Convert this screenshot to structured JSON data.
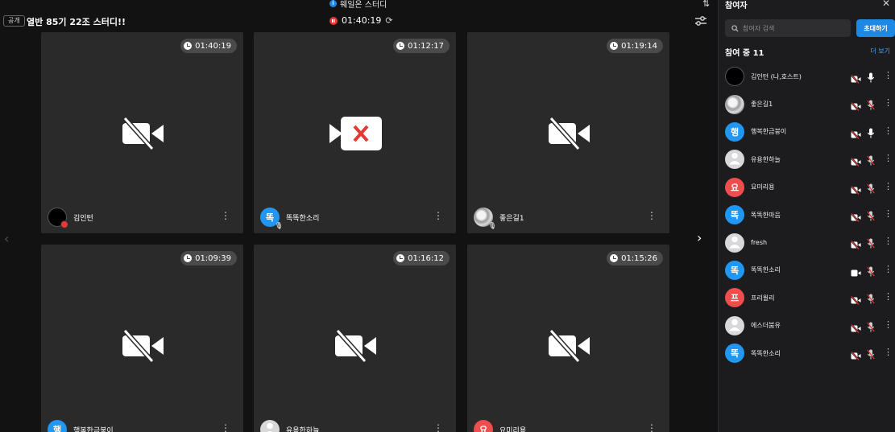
{
  "topbar": {
    "service_title": "웨일온 스터디"
  },
  "header": {
    "visibility_badge": "공개",
    "room_title": "열반 85기 22조 스터디!!",
    "recording_time": "01:40:19"
  },
  "tiles": [
    {
      "name": "김인턴",
      "timer": "01:40:19",
      "video": "camera-off",
      "avatar": {
        "type": "dark",
        "letter": ""
      },
      "badge": "host"
    },
    {
      "name": "똑똑한소리",
      "timer": "01:12:17",
      "video": "camera-error",
      "avatar": {
        "type": "blue",
        "letter": "똑"
      },
      "badge": "mic-off"
    },
    {
      "name": "좋은길1",
      "timer": "01:19:14",
      "video": "camera-off",
      "avatar": {
        "type": "photo",
        "letter": ""
      },
      "badge": "mic-off"
    },
    {
      "name": "행복한금붕이",
      "timer": "01:09:39",
      "video": "camera-off",
      "avatar": {
        "type": "blue",
        "letter": "행"
      },
      "badge": ""
    },
    {
      "name": "유용한하늘",
      "timer": "01:16:12",
      "video": "camera-off",
      "avatar": {
        "type": "gray",
        "letter": ""
      },
      "badge": ""
    },
    {
      "name": "요미리용",
      "timer": "01:15:26",
      "video": "camera-off",
      "avatar": {
        "type": "red",
        "letter": "요"
      },
      "badge": ""
    }
  ],
  "sidebar": {
    "title": "참여자",
    "search_placeholder": "참여자 검색",
    "invite_label": "초대하기",
    "count_label": "참여 중 11",
    "see_more_label": "더 보기",
    "participants": [
      {
        "name": "김인턴 (나,호스트)",
        "avatar": {
          "type": "dark",
          "letter": ""
        },
        "camera": "off",
        "mic": "on"
      },
      {
        "name": "좋은길1",
        "avatar": {
          "type": "photo",
          "letter": ""
        },
        "camera": "off",
        "mic": "off"
      },
      {
        "name": "행복한금붕이",
        "avatar": {
          "type": "blue",
          "letter": "행"
        },
        "camera": "off",
        "mic": "on"
      },
      {
        "name": "유용한하늘",
        "avatar": {
          "type": "gray",
          "letter": ""
        },
        "camera": "off",
        "mic": "off"
      },
      {
        "name": "요미리용",
        "avatar": {
          "type": "red",
          "letter": "요"
        },
        "camera": "off",
        "mic": "off"
      },
      {
        "name": "똑똑한마음",
        "avatar": {
          "type": "blue",
          "letter": "똑"
        },
        "camera": "off",
        "mic": "off"
      },
      {
        "name": "fresh",
        "avatar": {
          "type": "gray",
          "letter": ""
        },
        "camera": "off",
        "mic": "off"
      },
      {
        "name": "똑똑한소리",
        "avatar": {
          "type": "blue",
          "letter": "똑"
        },
        "camera": "on",
        "mic": "off"
      },
      {
        "name": "프리윌리",
        "avatar": {
          "type": "red",
          "letter": "프"
        },
        "camera": "off",
        "mic": "off"
      },
      {
        "name": "에스더붐유",
        "avatar": {
          "type": "gray",
          "letter": ""
        },
        "camera": "off",
        "mic": "off"
      },
      {
        "name": "똑똑한소리",
        "avatar": {
          "type": "blue",
          "letter": "똑"
        },
        "camera": "off",
        "mic": "off"
      }
    ]
  },
  "colors": {
    "accent": "#1e88e5",
    "record": "#e53935",
    "tile_bg": "#2a2a2a",
    "sidebar_bg": "#1c1c1e"
  }
}
